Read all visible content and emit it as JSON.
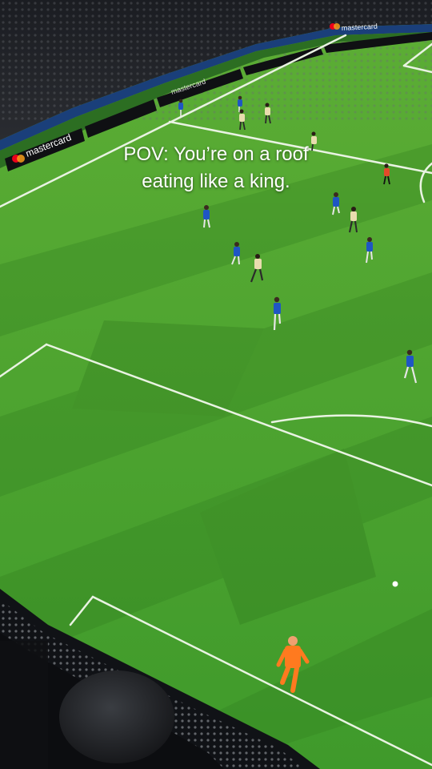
{
  "overlay": {
    "caption_line1": "POV: You’re on a roof",
    "caption_line2": "eating like a king."
  },
  "boards": [
    {
      "text": "mastercard"
    },
    {
      "text": "mastercard"
    },
    {
      "text": "mastercard"
    }
  ],
  "colors": {
    "pitch_light": "#5fb534",
    "pitch_dark": "#3c8f27",
    "home_kit": "#1f56c4",
    "away_kit": "#e8dcae",
    "goalkeeper_kit": "#ff7a1f"
  }
}
